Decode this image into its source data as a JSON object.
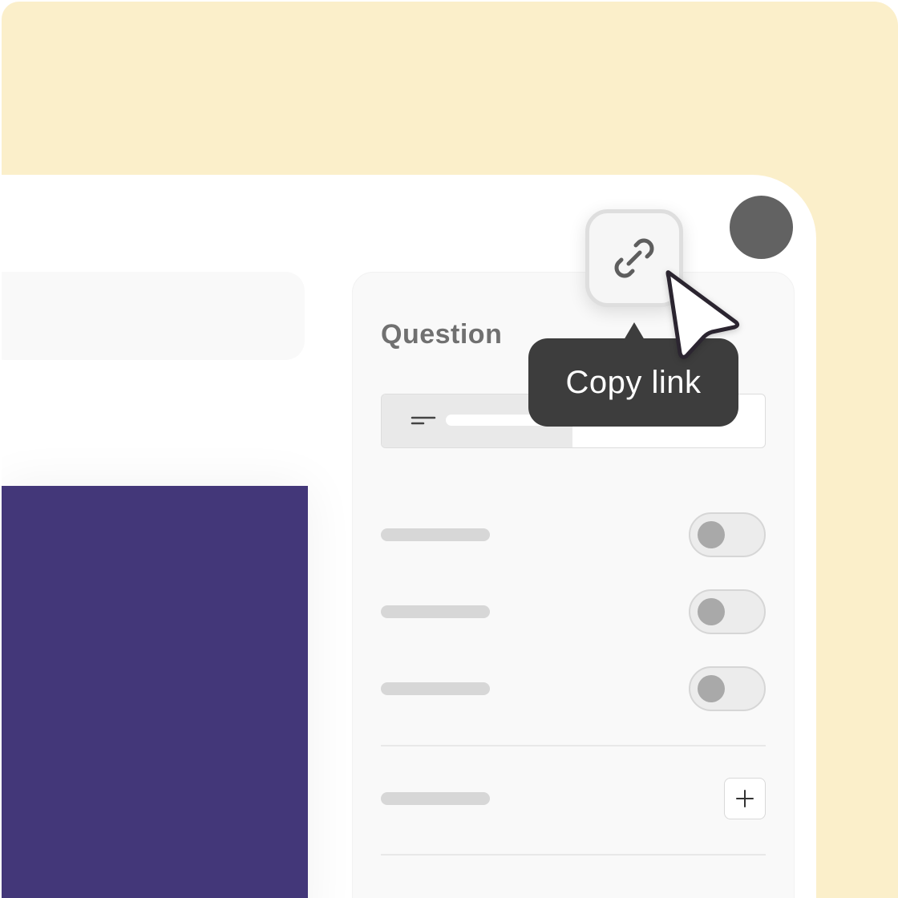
{
  "panel": {
    "title": "Question"
  },
  "tooltip": {
    "text": "Copy link"
  },
  "icons": {
    "link": "link-icon",
    "align": "align-left-icon",
    "plus": "plus-icon",
    "cursor": "cursor-pointer-icon"
  },
  "settings": {
    "toggles": [
      {
        "state": "off"
      },
      {
        "state": "off"
      },
      {
        "state": "off"
      }
    ]
  },
  "colors": {
    "background": "#fbefca",
    "media_block": "#433779",
    "tooltip": "#3d3d3d",
    "avatar": "#626262"
  }
}
